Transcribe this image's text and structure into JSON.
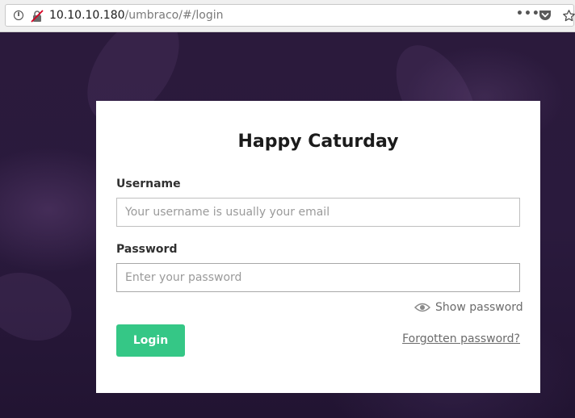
{
  "browser": {
    "url_host": "10.10.10.180",
    "url_path": "/umbraco/#/login",
    "info_icon": "info-icon",
    "security_icon": "insecure-lock-icon",
    "actions": [
      "page-actions-icon",
      "pocket-icon",
      "bookmark-star-icon"
    ]
  },
  "login": {
    "title": "Happy Caturday",
    "username_label": "Username",
    "username_value": "",
    "username_placeholder": "Your username is usually your email",
    "password_label": "Password",
    "password_value": "",
    "password_placeholder": "Enter your password",
    "show_password": "Show password",
    "login_button": "Login",
    "forgotten_password": "Forgotten password?"
  },
  "colors": {
    "accent": "#35c786",
    "background": "#2a1a3d",
    "card": "#ffffff"
  }
}
